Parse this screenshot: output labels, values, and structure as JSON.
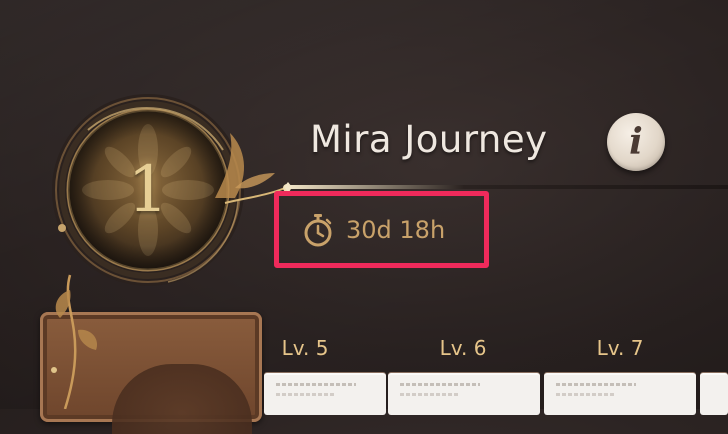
{
  "medallion": {
    "level_number": "1"
  },
  "header": {
    "title": "Mira Journey",
    "info_label": "i"
  },
  "timer": {
    "icon": "stopwatch-icon",
    "remaining": "30d 18h"
  },
  "levels": [
    {
      "label": "Lv. 5"
    },
    {
      "label": "Lv. 6"
    },
    {
      "label": "Lv. 7"
    }
  ],
  "colors": {
    "highlight": "#ef2a5b",
    "gold": "#c9a26a",
    "title_text": "#efe8e0",
    "background": "#2c2423"
  }
}
